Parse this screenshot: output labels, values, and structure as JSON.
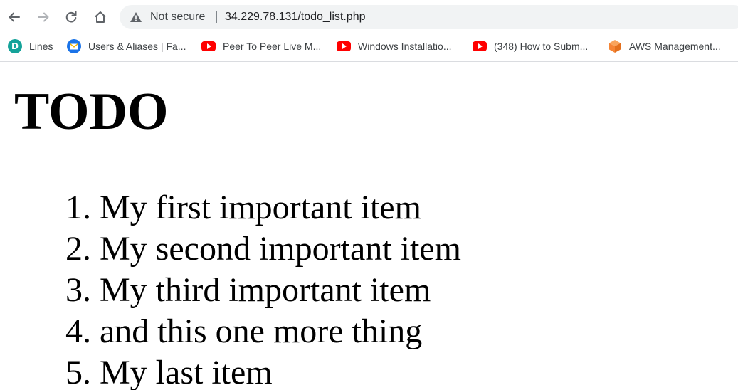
{
  "browser": {
    "security_label": "Not secure",
    "url": "34.229.78.131/todo_list.php",
    "icons": {
      "back": "arrow-left-icon",
      "forward": "arrow-right-icon",
      "reload": "reload-icon",
      "home": "home-icon",
      "security": "warning-triangle-icon"
    }
  },
  "bookmarks": [
    {
      "label": "Lines",
      "icon": "d-circle-icon",
      "color": "#15a39a"
    },
    {
      "label": "Users & Aliases | Fa...",
      "icon": "mail-icon",
      "color": "#1a73e8"
    },
    {
      "label": "Peer To Peer Live M...",
      "icon": "youtube-icon",
      "color": "#ff0000"
    },
    {
      "label": "Windows Installatio...",
      "icon": "youtube-icon",
      "color": "#ff0000"
    },
    {
      "label": "(348) How to Subm...",
      "icon": "youtube-icon",
      "color": "#ff0000"
    },
    {
      "label": "AWS Management...",
      "icon": "aws-cube-icon",
      "color": "#f58536"
    }
  ],
  "page": {
    "title": "TODO",
    "items": [
      {
        "number": "1.",
        "text": "My first important item"
      },
      {
        "number": "2.",
        "text": "My second important item"
      },
      {
        "number": "3.",
        "text": "My third important item"
      },
      {
        "number": "4.",
        "text": "and this one more thing"
      },
      {
        "number": "5.",
        "text": "My last item"
      }
    ]
  }
}
